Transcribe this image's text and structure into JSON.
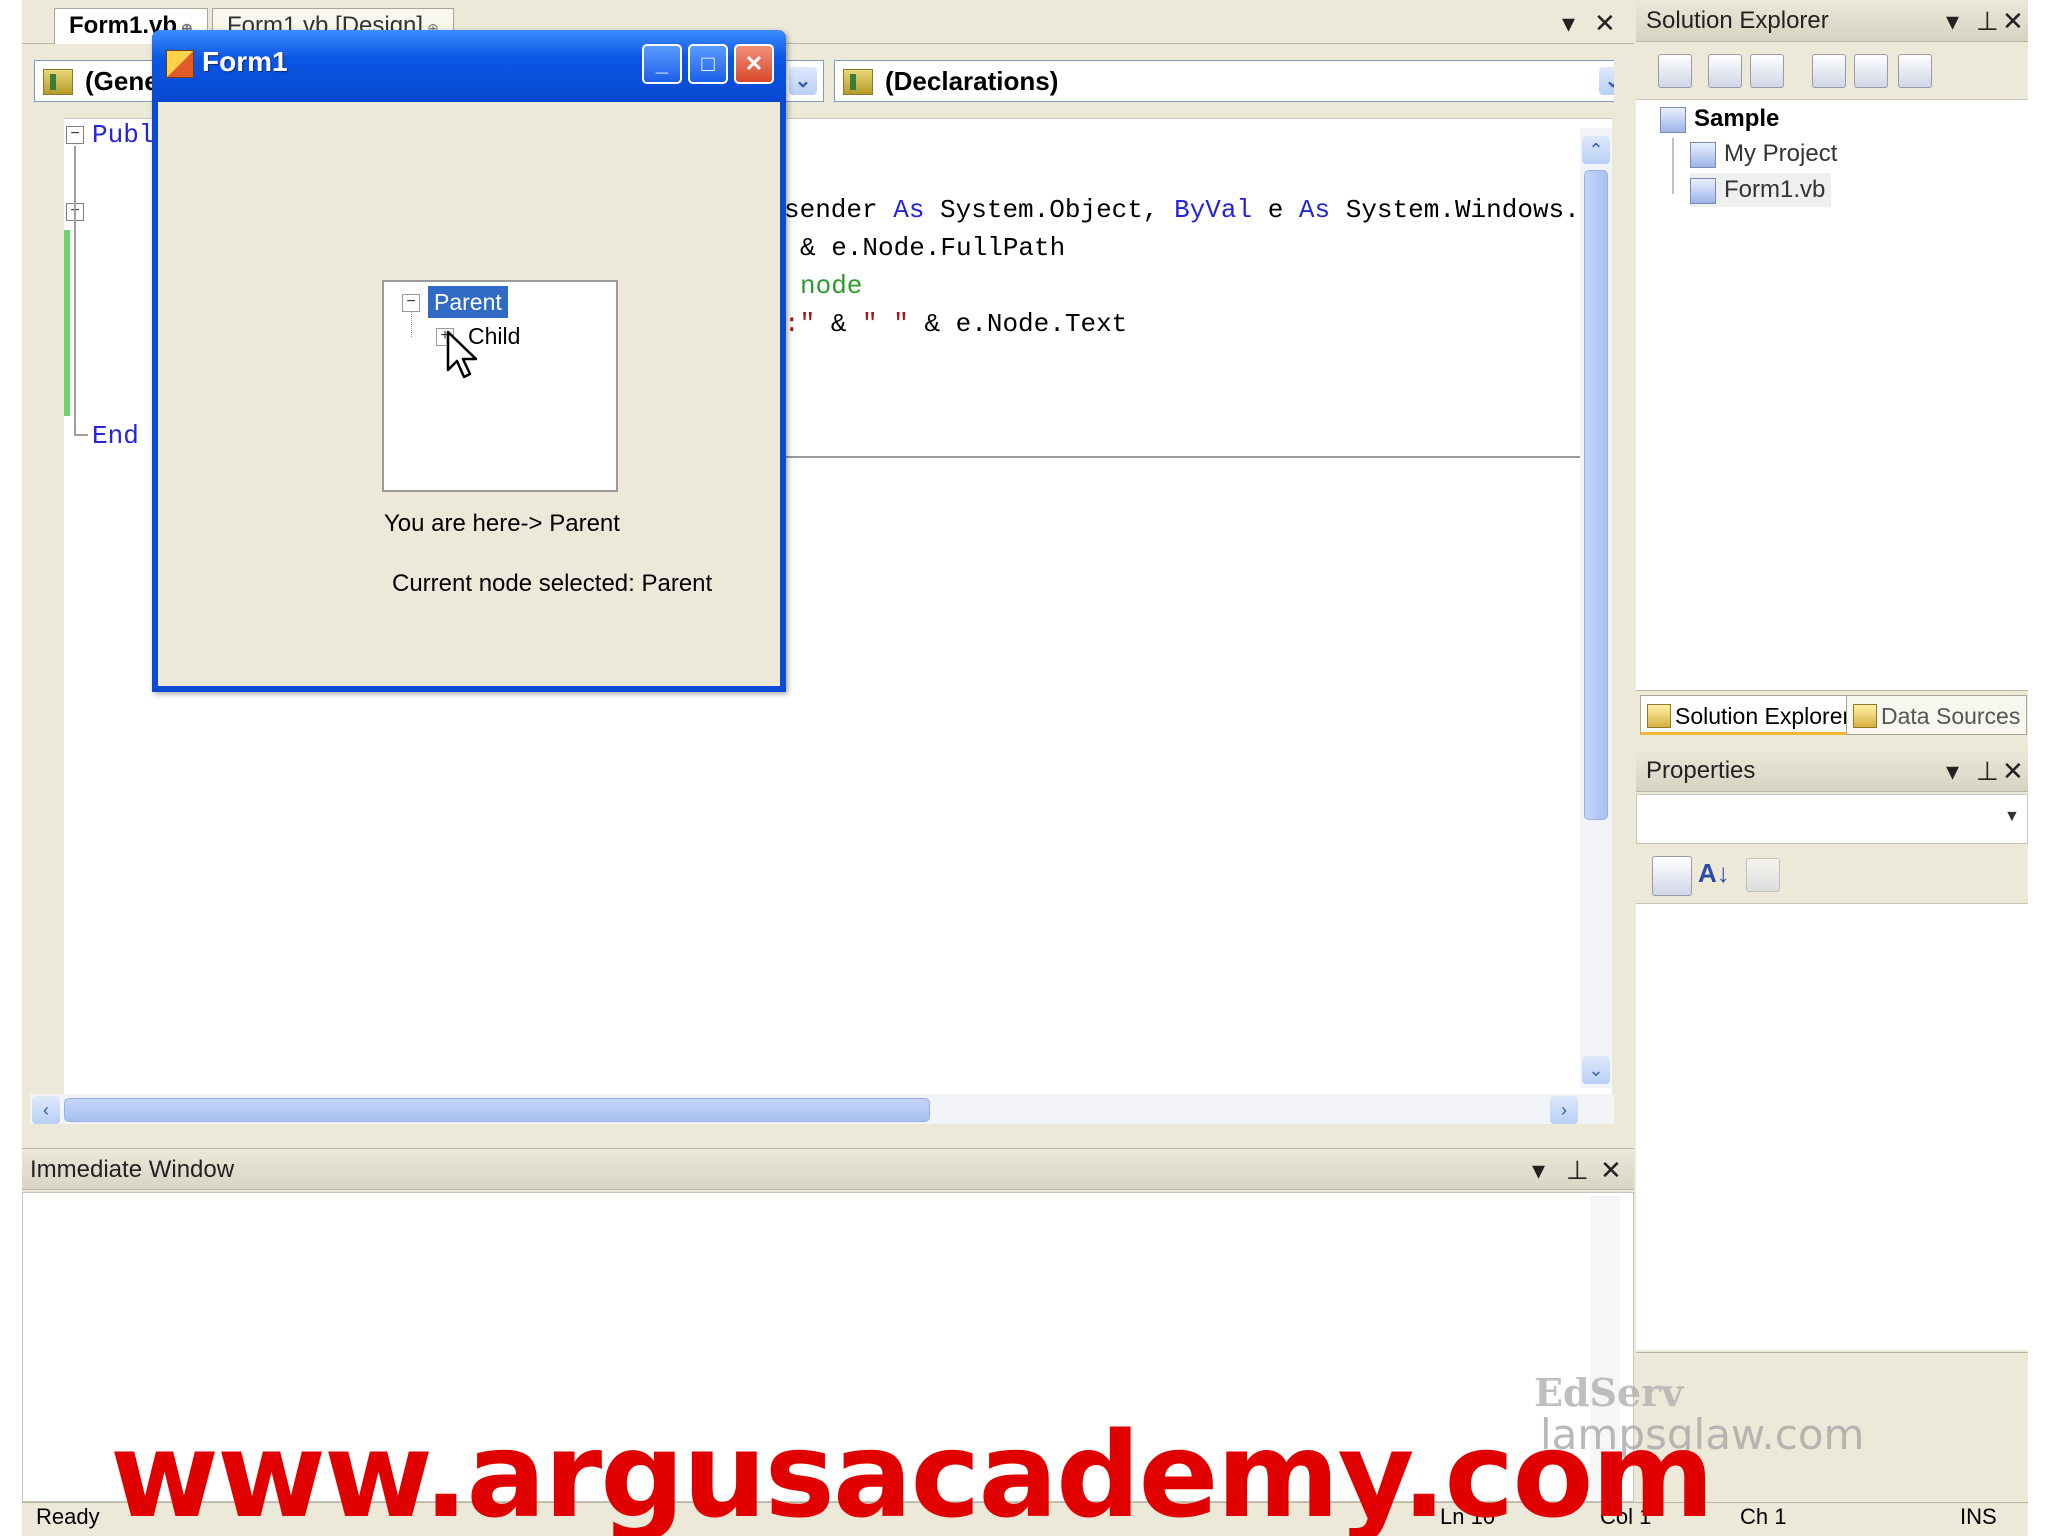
{
  "editor": {
    "tabs": [
      {
        "label": "Form1.vb"
      },
      {
        "label": "Form1.vb [Design]"
      }
    ],
    "class_combo": "(General)",
    "member_combo": "(Declarations)",
    "code": {
      "pub": "Publ",
      "line1_a": "sender ",
      "line1_kw1": "As",
      "line1_b": " System.Object, ",
      "line1_kw2": "ByVal",
      "line1_c": " e ",
      "line1_kw3": "As",
      "line1_d": " System.Windows.",
      "line2": "& e.Node.FullPath",
      "line3": "node",
      "line4_str1": ":\"",
      "line4_a": " & ",
      "line4_str2": "\" \"",
      "line4_b": " & e.Node.Text",
      "end": "End"
    }
  },
  "immediate_window": {
    "title": "Immediate Window"
  },
  "solution_explorer": {
    "title": "Solution Explorer",
    "tree": {
      "solution": "Sample",
      "items": [
        "My Project",
        "Form1.vb"
      ]
    },
    "tabs": [
      "Solution Explorer",
      "Data Sources"
    ]
  },
  "properties": {
    "title": "Properties"
  },
  "status_bar": {
    "ready": "Ready",
    "ln": "Ln 10",
    "col": "Col 1",
    "ch": "Ch 1",
    "ins": "INS"
  },
  "form1": {
    "title": "Form1",
    "tree": {
      "parent": "Parent",
      "child": "Child"
    },
    "label_here": "You are here-> Parent",
    "label_current": "Current node selected: Parent"
  },
  "watermarks": {
    "edserv": "EdServ",
    "lamp": "lampsglaw.com",
    "url": "www.argusacademy.com"
  },
  "colors": {
    "xp_blue_title": "#0a56e4",
    "selection": "#316ac5",
    "keyword": "#2525d8",
    "string": "#a31515",
    "comment": "#2e9a2e",
    "banner_red": "#e10000"
  }
}
